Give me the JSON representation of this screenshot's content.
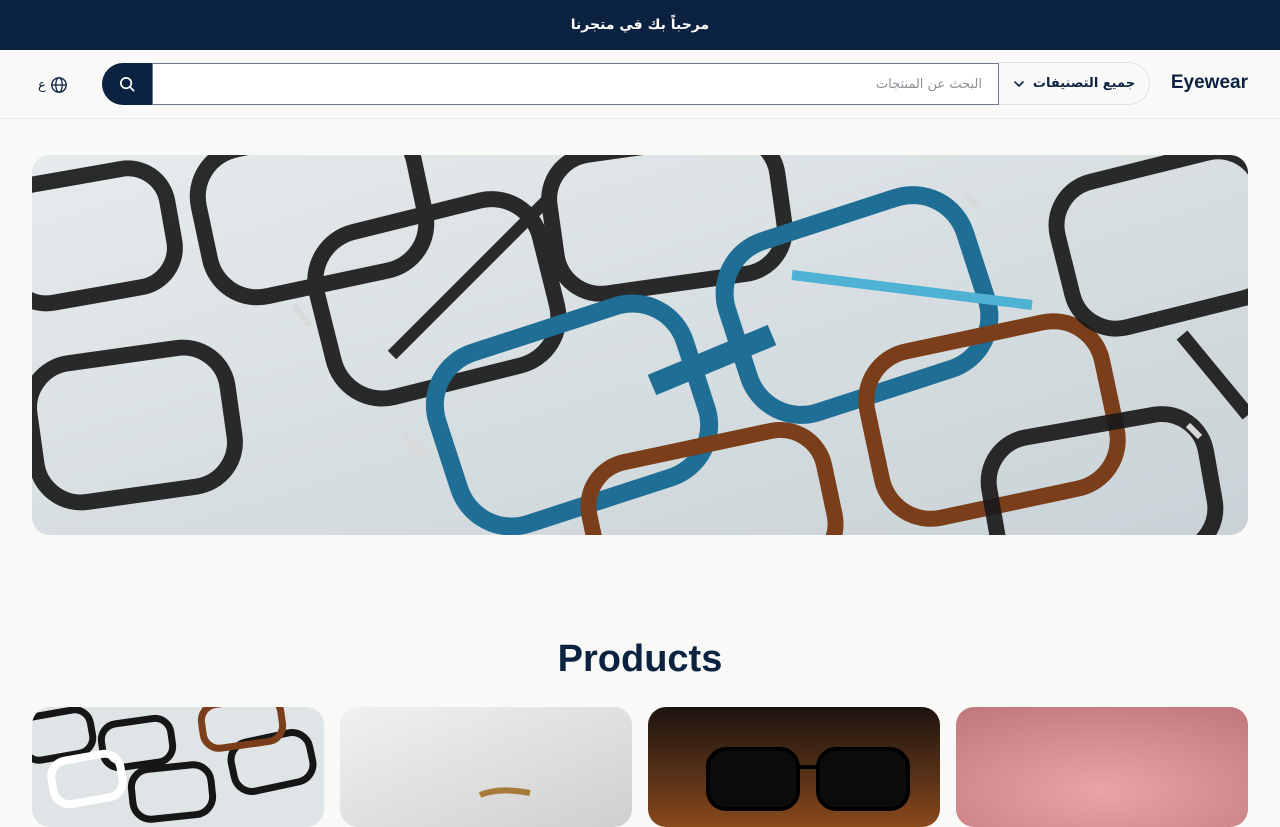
{
  "announcement": "مرحباً بك في متجرنا",
  "header": {
    "logo": "Eyewear",
    "category_select": {
      "selected": "جميع التصنيفات",
      "icon": "chevron-down-icon"
    },
    "search": {
      "placeholder": "البحث عن المنتجات",
      "value": "",
      "icon": "search-icon"
    },
    "language": {
      "label": "ع",
      "icon": "globe-icon"
    }
  },
  "hero": {
    "image": "eyeglasses-collection-photo"
  },
  "products": {
    "title": "Products",
    "cards": [
      {
        "image": "eyeglasses-pile-photo"
      },
      {
        "image": "wooden-sunglasses-photo"
      },
      {
        "image": "dark-sunglasses-photo"
      },
      {
        "image": "pink-backdrop-photo"
      }
    ]
  },
  "colors": {
    "navy": "#0b2340",
    "background": "#f9f9f7",
    "frame_blue": "#1f6e96",
    "tortoise": "#7a3e1a"
  }
}
